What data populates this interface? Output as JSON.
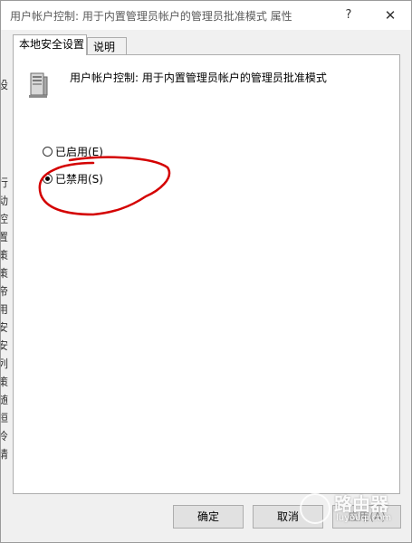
{
  "window": {
    "title": "用户帐户控制: 用于内置管理员帐户的管理员批准模式 属性",
    "help_label": "?",
    "close_label": "✕"
  },
  "tabs": [
    {
      "label": "本地安全设置",
      "active": true
    },
    {
      "label": "说明",
      "active": false
    }
  ],
  "policy": {
    "icon": "server-computer-icon",
    "title": "用户帐户控制: 用于内置管理员帐户的管理员批准模式"
  },
  "options": [
    {
      "label": "已启用(E)",
      "checked": false
    },
    {
      "label": "已禁用(S)",
      "checked": true
    }
  ],
  "buttons": {
    "ok": "确定",
    "cancel": "取消",
    "apply": "应用(A)"
  },
  "background_fragments": [
    "设",
    "行",
    "动",
    "控",
    "置",
    "策",
    "策",
    "帝",
    "用",
    "安",
    "安",
    "列",
    "策",
    "随",
    "桓",
    "冷",
    "请"
  ],
  "watermark": {
    "title": "路由器",
    "subtitle": "luyouqi.com"
  },
  "colors": {
    "annotation": "#d40000",
    "panel_bg": "#ffffff",
    "dialog_bg": "#f0f0f0"
  }
}
